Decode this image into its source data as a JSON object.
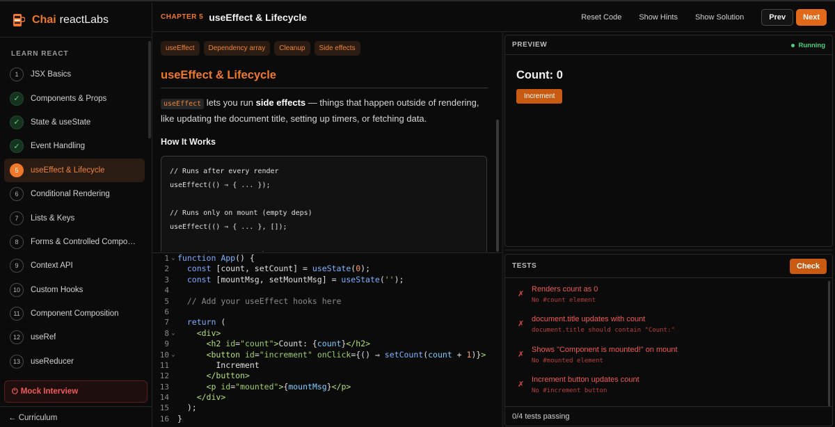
{
  "brand": {
    "name_highlight": "Chai",
    "name_rest": "reactLabs"
  },
  "sidebar": {
    "section_label": "LEARN REACT",
    "items": [
      {
        "badge": "1",
        "label": "JSX Basics",
        "state": "todo"
      },
      {
        "badge": "✓",
        "label": "Components & Props",
        "state": "done"
      },
      {
        "badge": "✓",
        "label": "State & useState",
        "state": "done"
      },
      {
        "badge": "✓",
        "label": "Event Handling",
        "state": "done"
      },
      {
        "badge": "5",
        "label": "useEffect & Lifecycle",
        "state": "active"
      },
      {
        "badge": "6",
        "label": "Conditional Rendering",
        "state": "todo"
      },
      {
        "badge": "7",
        "label": "Lists & Keys",
        "state": "todo"
      },
      {
        "badge": "8",
        "label": "Forms & Controlled Compone...",
        "state": "todo"
      },
      {
        "badge": "9",
        "label": "Context API",
        "state": "todo"
      },
      {
        "badge": "10",
        "label": "Custom Hooks",
        "state": "todo"
      },
      {
        "badge": "11",
        "label": "Component Composition",
        "state": "todo"
      },
      {
        "badge": "12",
        "label": "useRef",
        "state": "todo"
      },
      {
        "badge": "13",
        "label": "useReducer",
        "state": "todo"
      }
    ],
    "mock_interview": "Mock Interview",
    "curriculum_link": "← Curriculum"
  },
  "topbar": {
    "chapter": "CHAPTER 5",
    "title": "useEffect & Lifecycle",
    "reset": "Reset Code",
    "hints": "Show Hints",
    "solution": "Show Solution",
    "prev": "Prev",
    "next": "Next"
  },
  "lesson": {
    "tags": [
      "useEffect",
      "Dependency array",
      "Cleanup",
      "Side effects"
    ],
    "title": "useEffect & Lifecycle",
    "intro_code": "useEffect",
    "intro_1": " lets you run ",
    "intro_bold": "side effects",
    "intro_2": " — things that happen outside of rendering, like updating the document title, setting up timers, or fetching data.",
    "how_title": "How It Works",
    "code_lines": [
      "// Runs after every render",
      "useEffect(() ⇒ { ... });",
      "",
      "// Runs only on mount (empty deps)",
      "useEffect(() ⇒ { ... }, []);",
      "",
      "// Runs when \"count\" changes"
    ]
  },
  "preview": {
    "label": "PREVIEW",
    "status": "Running",
    "count_text": "Count: 0",
    "increment": "Increment"
  },
  "tests": {
    "label": "TESTS",
    "check": "Check",
    "items": [
      {
        "name": "Renders count as 0",
        "msg": "No #count element"
      },
      {
        "name": "document.title updates with count",
        "msg": "document.title should contain \"Count:\""
      },
      {
        "name": "Shows \"Component is mounted!\" on mount",
        "msg": "No #mounted element"
      },
      {
        "name": "Increment button updates count",
        "msg": "No #increment button"
      }
    ],
    "summary": "0/4 tests passing"
  },
  "colors": {
    "accent": "#f0782a",
    "success": "#4cd07d",
    "error": "#ef5a5a"
  }
}
